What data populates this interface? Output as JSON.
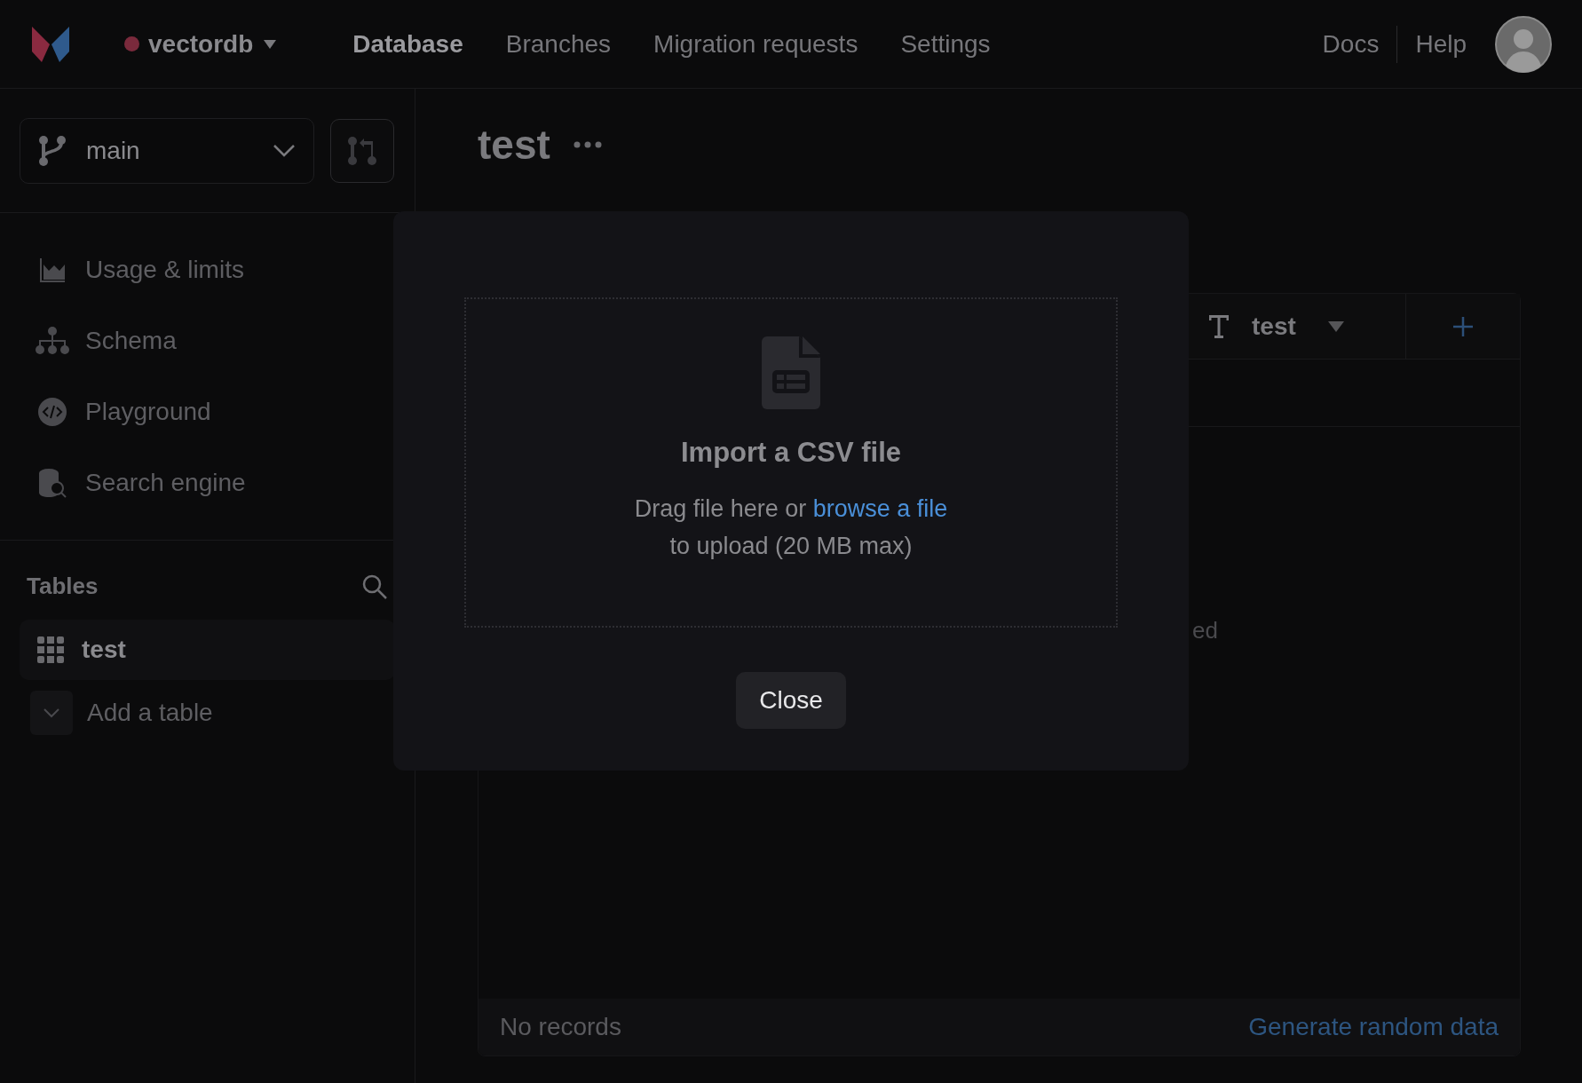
{
  "header": {
    "workspace": "vectordb",
    "nav": [
      {
        "label": "Database",
        "selected": true
      },
      {
        "label": "Branches",
        "selected": false
      },
      {
        "label": "Migration requests",
        "selected": false
      },
      {
        "label": "Settings",
        "selected": false
      }
    ],
    "links": [
      "Docs",
      "Help"
    ]
  },
  "sidebar": {
    "branch": "main",
    "items": [
      {
        "label": "Usage & limits",
        "kind": "usage"
      },
      {
        "label": "Schema",
        "kind": "schema"
      },
      {
        "label": "Playground",
        "kind": "playground"
      },
      {
        "label": "Search engine",
        "kind": "search"
      }
    ],
    "tables_title": "Tables",
    "tables": [
      {
        "label": "test",
        "selected": true
      }
    ],
    "add_table": "Add a table"
  },
  "main": {
    "title": "test",
    "table": {
      "column": "test",
      "empty_text": "ed",
      "footer": "No records",
      "generate": "Generate random data"
    }
  },
  "modal": {
    "title": "Import a CSV file",
    "text_before": "Drag file here or",
    "link": "browse a file",
    "text_after": "to upload (20 MB max)",
    "close": "Close"
  }
}
